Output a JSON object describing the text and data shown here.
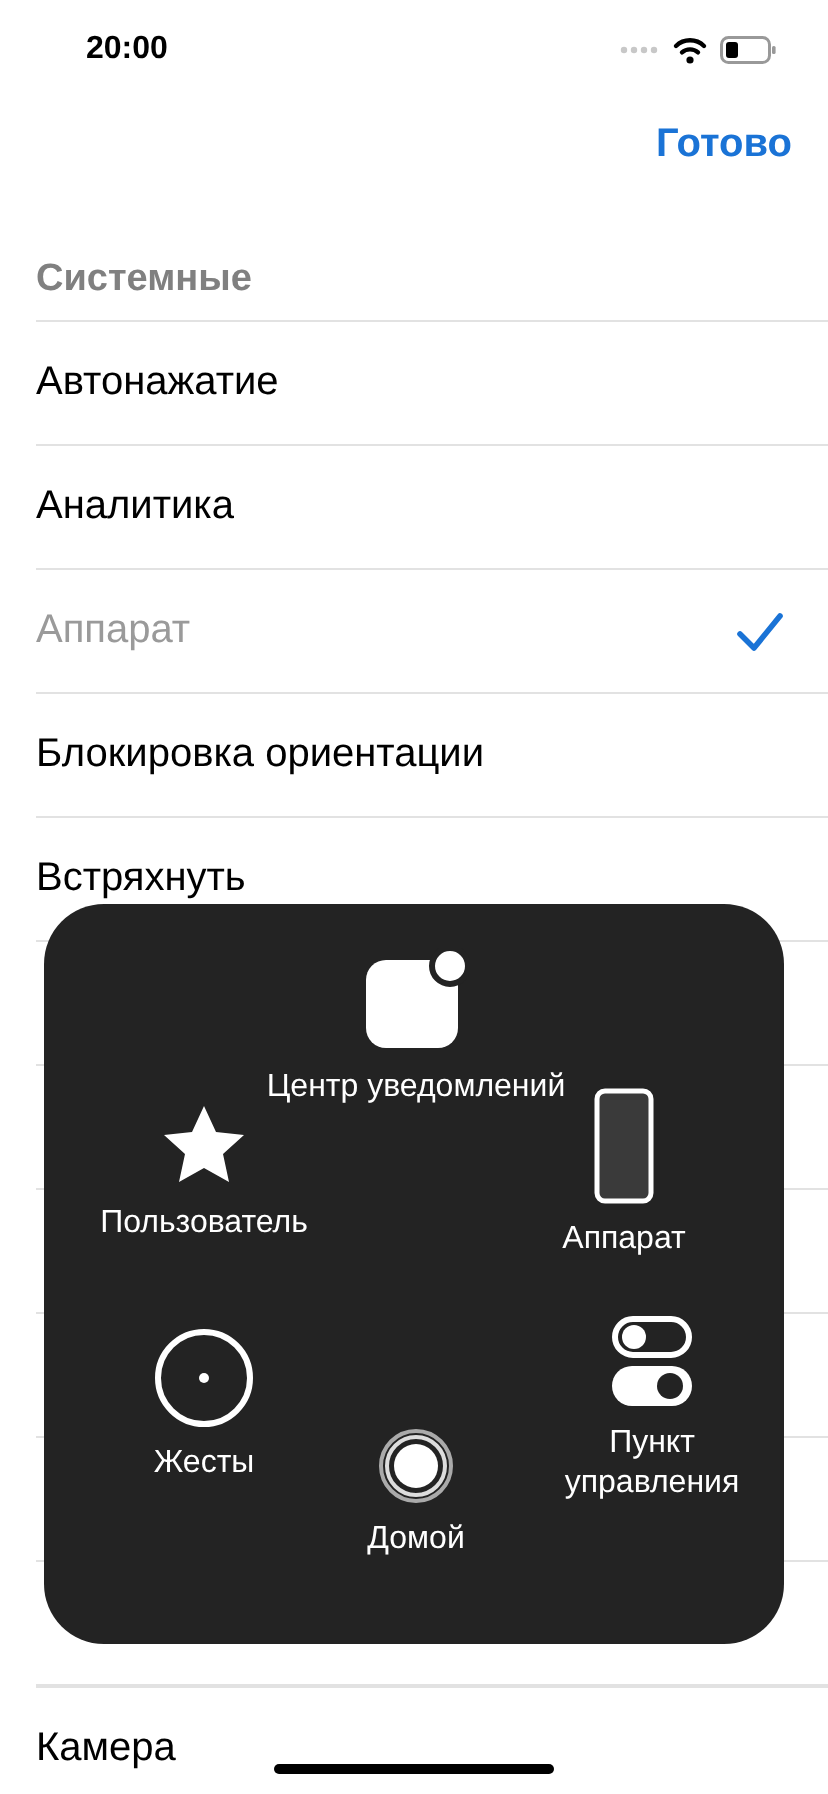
{
  "status_bar": {
    "time": "20:00"
  },
  "nav": {
    "done": "Готово"
  },
  "section": {
    "header": "Системные",
    "rows": [
      {
        "label": "Автонажатие",
        "disabled": false,
        "checked": false
      },
      {
        "label": "Аналитика",
        "disabled": false,
        "checked": false
      },
      {
        "label": "Аппарат",
        "disabled": true,
        "checked": true
      },
      {
        "label": "Блокировка ориентации",
        "disabled": false,
        "checked": false
      },
      {
        "label": "Встряхнуть",
        "disabled": false,
        "checked": false
      },
      {
        "label": "Камера",
        "disabled": false,
        "checked": false
      }
    ]
  },
  "menu": {
    "items": [
      {
        "kind": "notification",
        "label": "Центр уведомлений"
      },
      {
        "kind": "star",
        "label": "Пользователь"
      },
      {
        "kind": "device",
        "label": "Аппарат"
      },
      {
        "kind": "gesture",
        "label": "Жесты"
      },
      {
        "kind": "home",
        "label": "Домой"
      },
      {
        "kind": "control",
        "label": "Пункт управления"
      }
    ]
  }
}
